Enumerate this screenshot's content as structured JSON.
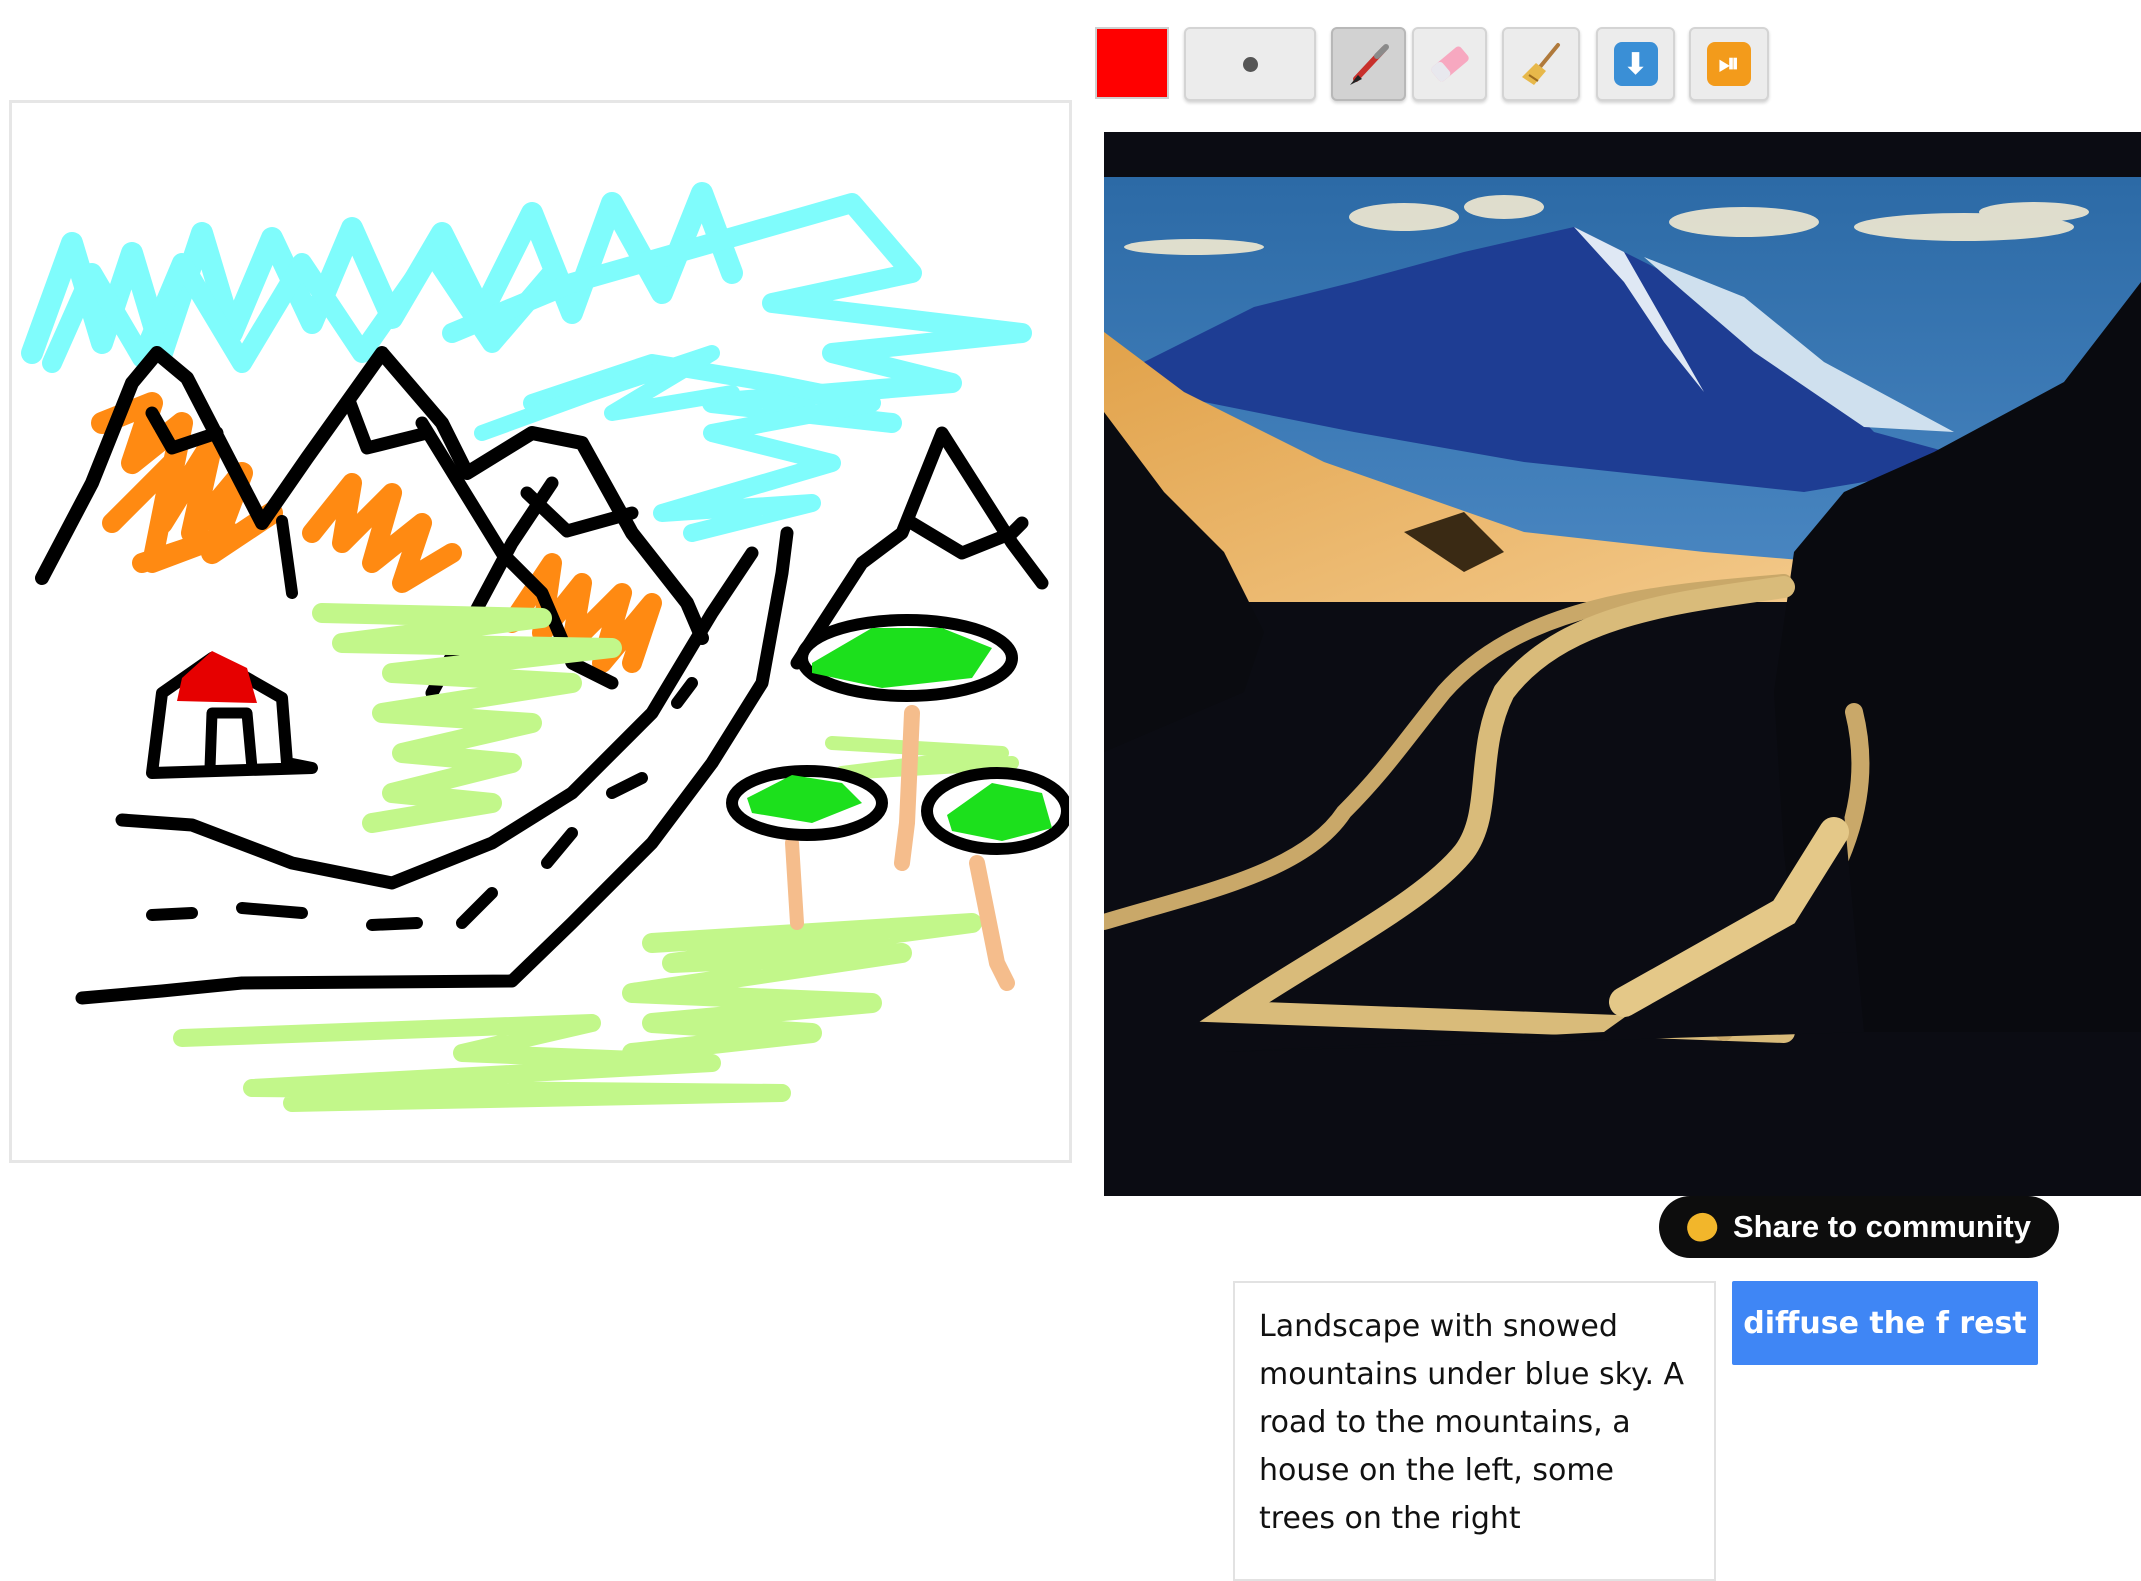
{
  "toolbar": {
    "color": "#ff0000",
    "tools": [
      {
        "name": "brush-size-button",
        "icon": "dot-icon"
      },
      {
        "name": "brush-button",
        "icon": "paintbrush-icon"
      },
      {
        "name": "eraser-button",
        "icon": "eraser-icon"
      },
      {
        "name": "clear-button",
        "icon": "broom-icon"
      },
      {
        "name": "download-button",
        "icon": "down-arrow-icon"
      },
      {
        "name": "play-pause-button",
        "icon": "play-pause-icon"
      }
    ]
  },
  "share": {
    "label": "Share to community",
    "icon": "clapping-hands-icon"
  },
  "prompt": {
    "text": "Landscape with snowed mountains under blue sky. A road to the mountains, a house on the left, some trees on the right"
  },
  "run_button": {
    "label": "diffuse the f rest"
  },
  "colors": {
    "cyan": "#7ffcfc",
    "orange": "#ff8a12",
    "lightgreen": "#c2f78a",
    "green": "#1ce01c",
    "trunk": "#f5bd8c",
    "roof": "#e60000",
    "accent": "#3f86f5"
  }
}
